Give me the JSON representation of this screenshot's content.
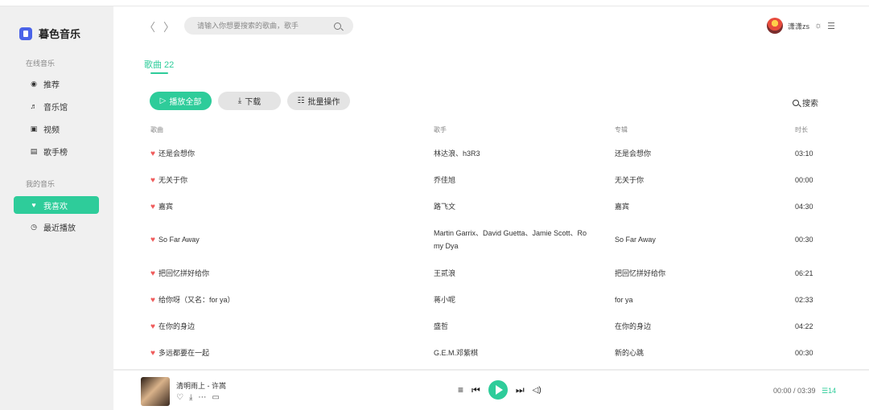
{
  "sidebar": {
    "brand": "暮色音乐",
    "sections": [
      {
        "title": "在线音乐",
        "items": [
          {
            "label": "推荐",
            "icon": "record-icon"
          },
          {
            "label": "音乐馆",
            "icon": "music-note-icon"
          },
          {
            "label": "视频",
            "icon": "video-icon"
          },
          {
            "label": "歌手榜",
            "icon": "chart-icon"
          }
        ]
      },
      {
        "title": "我的音乐",
        "items": [
          {
            "label": "我喜欢",
            "icon": "heart-icon",
            "active": true
          },
          {
            "label": "最近播放",
            "icon": "clock-icon"
          }
        ]
      }
    ]
  },
  "header": {
    "search_placeholder": "请输入你想要搜索的歌曲，歌手",
    "username": "潇潇zs"
  },
  "main": {
    "tab_label": "歌曲 22",
    "play_all": "播放全部",
    "download": "下载",
    "batch": "批量操作",
    "table_search": "搜索",
    "columns": {
      "song": "歌曲",
      "artist": "歌手",
      "album": "专辑",
      "duration": "时长"
    },
    "rows": [
      {
        "song": "还是会想你",
        "artist": "林达浪、h3R3",
        "album": "还是会想你",
        "duration": "03:10"
      },
      {
        "song": "无关于你",
        "artist": "乔佳旭",
        "album": "无关于你",
        "duration": "00:00"
      },
      {
        "song": "嘉宾",
        "artist": "路飞文",
        "album": "嘉宾",
        "duration": "04:30"
      },
      {
        "song": "So Far Away",
        "artist_line1": "Martin Garrix、David Guetta、Jamie Scott、Ro",
        "artist_line2": "my Dya",
        "album": "So Far Away",
        "duration": "00:30"
      },
      {
        "song": "把回忆拼好给你",
        "artist": "王贰浪",
        "album": "把回忆拼好给你",
        "duration": "06:21"
      },
      {
        "song": "给你呀（又名：for ya）",
        "artist": "蒋小呢",
        "album": "for ya",
        "duration": "02:33"
      },
      {
        "song": "在你的身边",
        "artist": "盛哲",
        "album": "在你的身边",
        "duration": "04:22"
      },
      {
        "song": "多远都要在一起",
        "artist": "G.E.M.邓紫棋",
        "album": "新的心跳",
        "duration": "00:30"
      }
    ]
  },
  "player": {
    "title": "清明雨上 - 许嵩",
    "time": "00:00 / 03:39",
    "queue_count": "14",
    "accent": "#2ecc9a"
  }
}
